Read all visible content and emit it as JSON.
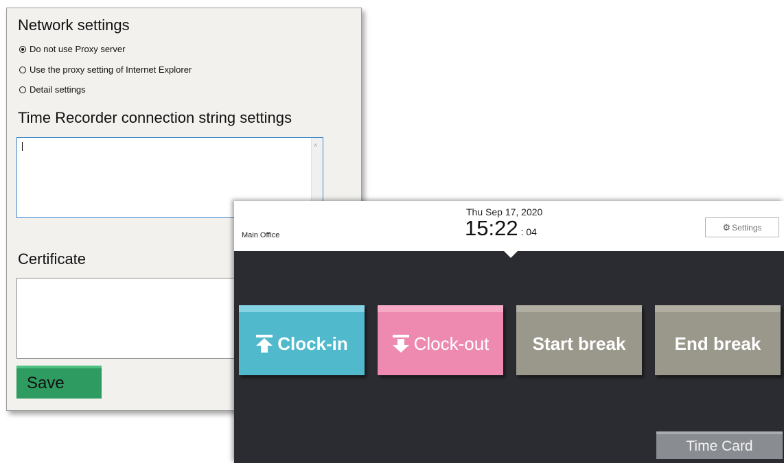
{
  "settings_window": {
    "network_title": "Network settings",
    "proxy_options": [
      {
        "label": "Do not use Proxy server",
        "selected": true
      },
      {
        "label": "Use the proxy setting of Internet Explorer",
        "selected": false
      },
      {
        "label": "Detail settings",
        "selected": false
      }
    ],
    "connection_title": "Time Recorder connection string settings",
    "connection_value": "",
    "certificate_title": "Certificate",
    "certificate_value": "",
    "save_label": "Save"
  },
  "recorder": {
    "location": "Main Office",
    "date": "Thu Sep 17, 2020",
    "time_hm": "15:22",
    "time_sec": ": 04",
    "settings_label": "Settings",
    "settings_icon": "gear-icon",
    "buttons": {
      "clock_in": "Clock-in",
      "clock_out": "Clock-out",
      "start_break": "Start break",
      "end_break": "End break"
    },
    "time_card_label": "Time Card"
  },
  "colors": {
    "clock_in": "#51b9cc",
    "clock_out": "#ee8ab0",
    "break": "#9a978b",
    "save": "#2e9b60",
    "recorder_bg": "#2b2c31"
  }
}
